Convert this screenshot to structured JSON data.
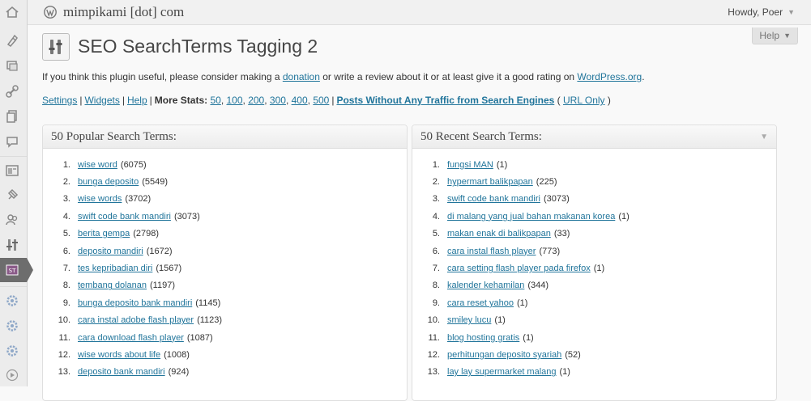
{
  "header": {
    "site_title": "mimpikami [dot] com",
    "howdy": "Howdy, Poer",
    "help_label": "Help"
  },
  "menu_icons": [
    "dashboard-icon",
    "posts-icon",
    "media-icon",
    "links-icon",
    "pages-icon",
    "comments-icon",
    "appearance-icon",
    "plugins-icon",
    "users-icon",
    "tools-icon",
    "seo-plugin-icon",
    "settings-icon",
    "settings-icon",
    "settings-icon",
    "collapse-icon"
  ],
  "page": {
    "title": "SEO SearchTerms Tagging 2",
    "intro_before": "If you think this plugin useful, please consider making a ",
    "donation_link": "donation",
    "intro_middle": " or write a review about it or at least give it a good rating on ",
    "wp_link": "WordPress.org",
    "intro_end": "."
  },
  "links": {
    "settings": "Settings",
    "widgets": "Widgets",
    "help": "Help",
    "more_stats": "More Stats:",
    "stats": [
      "50",
      "100",
      "200",
      "300",
      "400",
      "500"
    ],
    "no_traffic": "Posts Without Any Traffic from Search Engines",
    "url_only_open": "(",
    "url_only": "URL Only",
    "url_only_close": ")"
  },
  "popular": {
    "title": "50 Popular Search Terms:",
    "items": [
      {
        "term": "wise word",
        "count": "(6075)"
      },
      {
        "term": "bunga deposito",
        "count": "(5549)"
      },
      {
        "term": "wise words",
        "count": "(3702)"
      },
      {
        "term": "swift code bank mandiri",
        "count": "(3073)"
      },
      {
        "term": "berita gempa",
        "count": "(2798)"
      },
      {
        "term": "deposito mandiri",
        "count": "(1672)"
      },
      {
        "term": "tes kepribadian diri",
        "count": "(1567)"
      },
      {
        "term": "tembang dolanan",
        "count": "(1197)"
      },
      {
        "term": "bunga deposito bank mandiri",
        "count": "(1145)"
      },
      {
        "term": "cara instal adobe flash player",
        "count": "(1123)"
      },
      {
        "term": "cara download flash player",
        "count": "(1087)"
      },
      {
        "term": "wise words about life",
        "count": "(1008)"
      },
      {
        "term": "deposito bank mandiri",
        "count": "(924)"
      }
    ]
  },
  "recent": {
    "title": "50 Recent Search Terms:",
    "items": [
      {
        "term": "fungsi MAN",
        "count": "(1)"
      },
      {
        "term": "hypermart balikpapan",
        "count": "(225)"
      },
      {
        "term": "swift code bank mandiri",
        "count": "(3073)"
      },
      {
        "term": "di malang yang jual bahan makanan korea",
        "count": "(1)"
      },
      {
        "term": "makan enak di balikpapan",
        "count": "(33)"
      },
      {
        "term": "cara instal flash player",
        "count": "(773)"
      },
      {
        "term": "cara setting flash player pada firefox",
        "count": "(1)"
      },
      {
        "term": "kalender kehamilan",
        "count": "(344)"
      },
      {
        "term": "cara reset yahoo",
        "count": "(1)"
      },
      {
        "term": "smiley lucu",
        "count": "(1)"
      },
      {
        "term": "blog hosting gratis",
        "count": "(1)"
      },
      {
        "term": "perhitungan deposito syariah",
        "count": "(52)"
      },
      {
        "term": "lay lay supermarket malang",
        "count": "(1)"
      }
    ]
  }
}
